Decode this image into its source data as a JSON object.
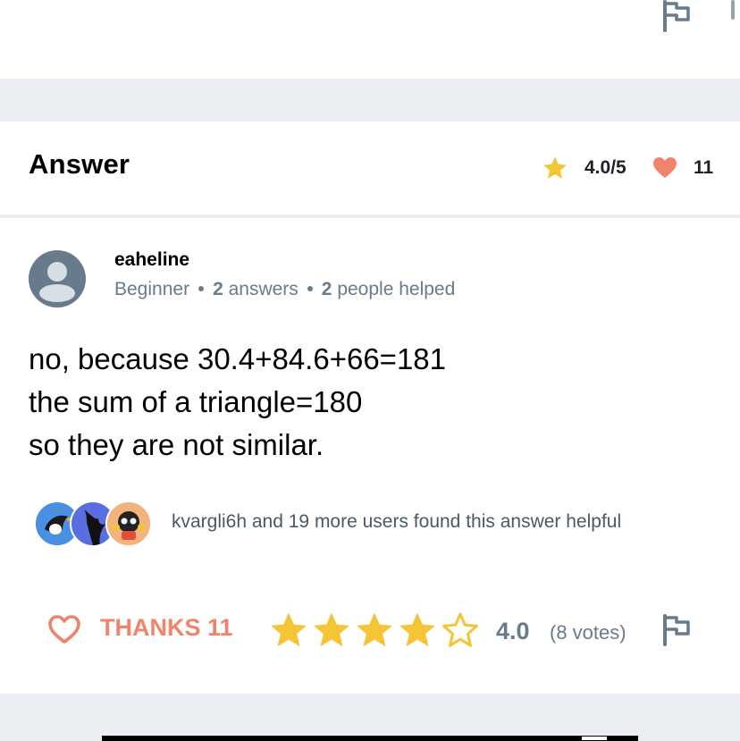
{
  "answer_header": {
    "title": "Answer",
    "rating": "4.0/5",
    "thanks_count": "11"
  },
  "author": {
    "username": "eaheline",
    "rank": "Beginner",
    "answers_count": "2",
    "answers_label": "answers",
    "helped_count": "2",
    "helped_label": "people helped"
  },
  "answer_body": {
    "lines": [
      "no, because 30.4+84.6+66=181",
      "the sum of a triangle=180",
      "so they are not similar."
    ]
  },
  "helpful": {
    "text": "kvargli6h and 19 more users found this answer helpful"
  },
  "actions": {
    "thanks_label": "THANKS 11",
    "rating_value": "4.0",
    "votes_label": "(8 votes)",
    "stars_filled": 4,
    "stars_total": 5
  },
  "colors": {
    "accent_star": "#f5c538",
    "accent_heart": "#ef836b",
    "muted_text": "#687b8c",
    "background_gap": "#ebeff3"
  },
  "icons": [
    "flag-icon",
    "star-icon",
    "heart-icon",
    "user-avatar-icon"
  ]
}
